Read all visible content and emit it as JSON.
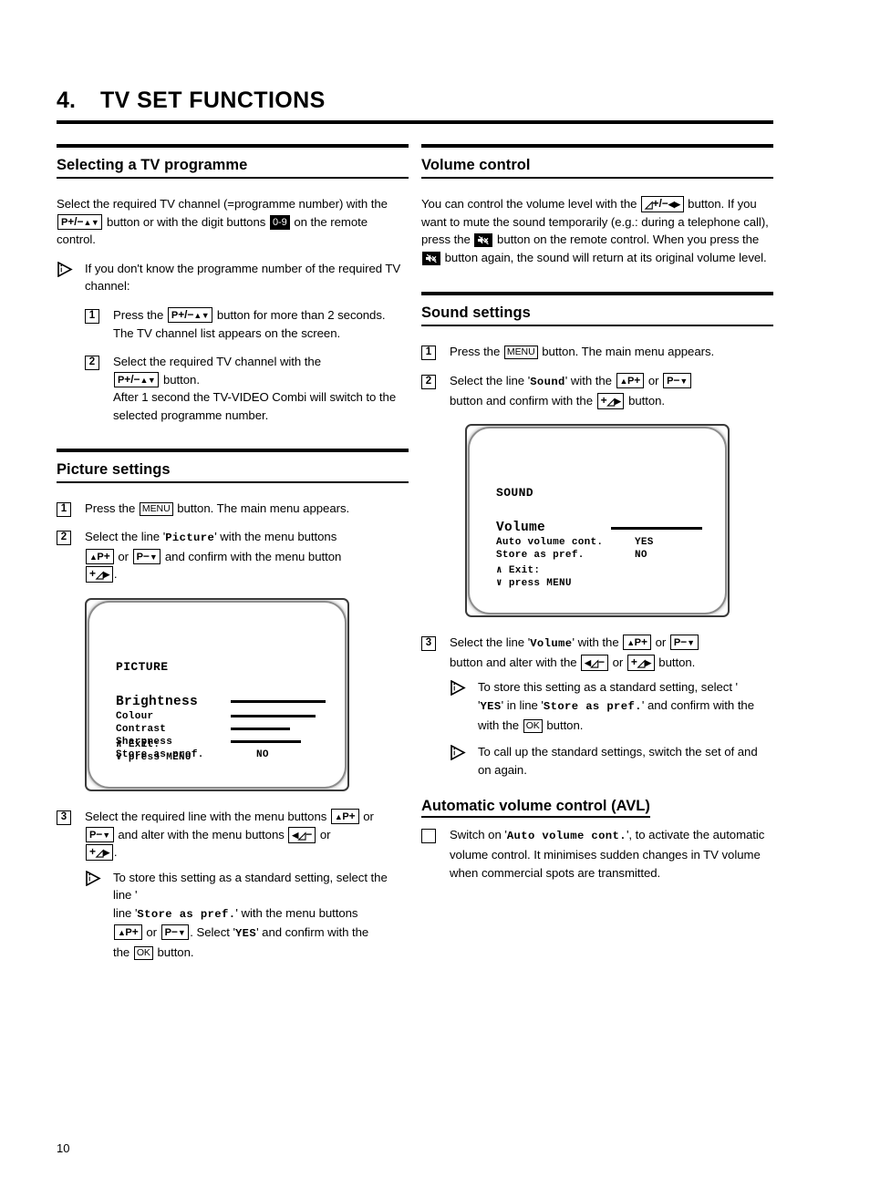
{
  "chapter": {
    "number": "4.",
    "title": "TV SET FUNCTIONS"
  },
  "page_number": "10",
  "keys": {
    "p_plus_minus_updown": "P +/− ▲▼",
    "digits": "0-9",
    "menu": "MENU",
    "ok": "OK",
    "up_p_plus": "▲P +",
    "p_minus_down": "P −▼",
    "plus_vol_right": "+ ◿▶",
    "left_vol_minus": "◀ ◿ −",
    "vol_plus_minus_leftright": "◿ +/− ◀▶",
    "mute": "mute-button"
  },
  "left_column": {
    "section_1": {
      "title": "Selecting a TV programme",
      "intro_1": "Select the required TV channel (=programme number) with the",
      "intro_2": "button or with the digit buttons",
      "intro_3": "on the remote control.",
      "note": {
        "icon": "info-icon",
        "text": "If you don't know the programme number of the required TV channel:"
      },
      "steps": [
        {
          "number": "1",
          "text_1": "Press the",
          "text_2": "button for more than 2 seconds. The TV channel list appears on the screen."
        },
        {
          "number": "2",
          "text_1": "Select the required TV channel with the",
          "text_2": "button.",
          "text_3": "After 1 second the TV-VIDEO Combi will switch to the selected programme number."
        }
      ]
    },
    "section_2": {
      "title": "Picture settings",
      "steps": [
        {
          "number": "1",
          "text_1": "Press the",
          "key": "MENU",
          "text_2": "button. The main menu appears."
        },
        {
          "number": "2",
          "text_1": "Select the line '",
          "menu_item": "Picture",
          "text_2": "' with the menu buttons",
          "text_3": "or",
          "text_4": "and confirm with the menu button",
          "text_5": "."
        },
        {
          "number": "3",
          "text_1": "Select the required line with the menu buttons",
          "text_2": "or",
          "text_3": "and alter with the menu buttons",
          "text_4": "or",
          "text_5": ".",
          "note": {
            "text_1": "To store this setting as a standard setting, select the line '",
            "menu_item": "Store as pref.",
            "text_2": "' with the menu buttons",
            "text_3": "or",
            "text_4": ". Select '",
            "value": "YES",
            "text_5": "' and confirm with the",
            "text_6": "button."
          }
        }
      ],
      "osd": {
        "title": "PICTURE",
        "lines": [
          {
            "label": "Brightness",
            "selected": true,
            "bar": 100,
            "value": ""
          },
          {
            "label": "Colour",
            "selected": false,
            "bar": 87,
            "value": ""
          },
          {
            "label": "Contrast",
            "selected": false,
            "bar": 61,
            "value": ""
          },
          {
            "label": "Sharpness",
            "selected": false,
            "bar": 72,
            "value": ""
          },
          {
            "label": "Store as pref.",
            "selected": false,
            "bar": 0,
            "value": "NO"
          }
        ],
        "footer_1": "∧ Exit:",
        "footer_2": "∨ press MENU"
      }
    }
  },
  "right_column": {
    "section_1": {
      "title": "Volume control",
      "text_1": "You can control the volume level with the",
      "text_2": "button. If you want to mute the sound temporarily (e.g.: during a telephone call), press the",
      "text_3": "button on the remote control. When you press the",
      "text_4": "button again, the sound will return at its original volume level."
    },
    "section_2": {
      "title": "Sound settings",
      "steps": [
        {
          "number": "1",
          "text_1": "Press the",
          "key": "MENU",
          "text_2": "button. The main menu appears."
        },
        {
          "number": "2",
          "text_1": "Select the line '",
          "menu_item": "Sound",
          "text_2": "' with the",
          "text_3": "or",
          "text_4": "button and confirm with the",
          "text_5": "button."
        },
        {
          "number": "3",
          "text_1": "Select the line '",
          "menu_item": "Volume",
          "text_2": "' with the",
          "text_3": "or",
          "text_4": "button and alter with the",
          "text_5": "or",
          "text_6": "button.",
          "note_1": {
            "text_1": "To store this setting as a standard setting, select '",
            "value": "YES",
            "text_2": "' in line '",
            "menu_item": "Store as pref.",
            "text_3": "' and confirm with the",
            "text_4": "button."
          },
          "note_2": {
            "text": "To call up the standard settings, switch the set of and on again."
          }
        }
      ],
      "osd": {
        "title": "SOUND",
        "lines": [
          {
            "label": "Volume",
            "selected": true,
            "bar": 100,
            "value": ""
          },
          {
            "label": "Auto volume cont.",
            "selected": false,
            "bar": 0,
            "value": "YES"
          },
          {
            "label": "Store as pref.",
            "selected": false,
            "bar": 0,
            "value": "NO"
          }
        ],
        "footer_1": "∧ Exit:",
        "footer_2": "∨ press MENU"
      }
    },
    "section_3": {
      "title": "Automatic volume control (AVL)",
      "bullet": {
        "text_1": "Switch on '",
        "menu_item": "Auto volume cont.",
        "text_2": "', to activate the automatic volume control. It minimises sudden changes in TV volume when commercial spots are transmitted."
      }
    }
  }
}
